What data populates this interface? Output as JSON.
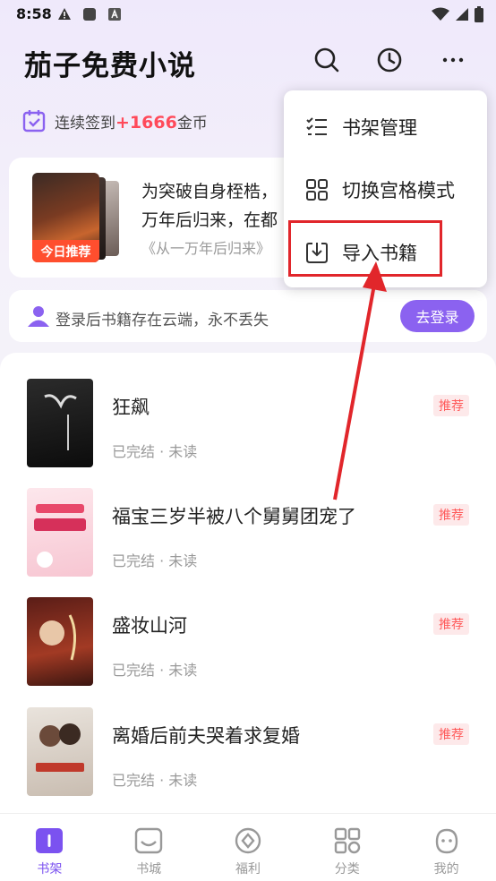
{
  "status_bar": {
    "time": "8:58"
  },
  "header": {
    "title": "茄子免费小说"
  },
  "checkin": {
    "prefix": "连续签到",
    "amount": "+1666",
    "suffix": "金币"
  },
  "recommend": {
    "tag": "今日推荐",
    "desc_line1": "为突破自身桎梏，",
    "desc_line2": "万年后归来，在都",
    "source": "《从一万年后归来》"
  },
  "login_bar": {
    "text": "登录后书籍存在云端，永不丢失",
    "button": "去登录"
  },
  "books": [
    {
      "title": "狂飙",
      "status": "已完结 · 未读",
      "badge": "推荐"
    },
    {
      "title": "福宝三岁半被八个舅舅团宠了",
      "status": "已完结 · 未读",
      "badge": "推荐"
    },
    {
      "title": "盛妆山河",
      "status": "已完结 · 未读",
      "badge": "推荐"
    },
    {
      "title": "离婚后前夫哭着求复婚",
      "status": "已完结 · 未读",
      "badge": "推荐"
    }
  ],
  "menu": {
    "items": [
      {
        "label": "书架管理",
        "icon": "list-check-icon"
      },
      {
        "label": "切换宫格模式",
        "icon": "grid-icon"
      },
      {
        "label": "导入书籍",
        "icon": "import-icon"
      }
    ]
  },
  "bottom_nav": [
    {
      "label": "书架",
      "icon": "bookshelf-icon",
      "active": true
    },
    {
      "label": "书城",
      "icon": "bookstore-icon",
      "active": false
    },
    {
      "label": "福利",
      "icon": "welfare-icon",
      "active": false
    },
    {
      "label": "分类",
      "icon": "category-icon",
      "active": false
    },
    {
      "label": "我的",
      "icon": "profile-icon",
      "active": false
    }
  ],
  "colors": {
    "accent": "#7b52f0",
    "highlight": "#e1262b",
    "price": "#ff4a5a"
  }
}
